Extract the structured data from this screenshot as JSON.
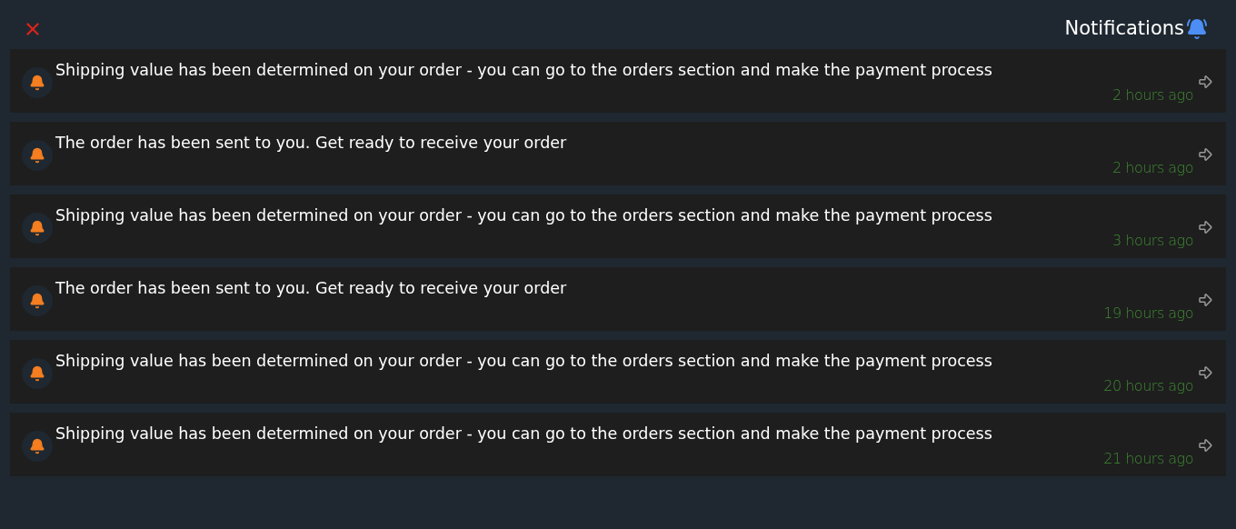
{
  "header": {
    "title": "Notifications"
  },
  "notifications": [
    {
      "message": "Shipping value has been determined on your order - you can go to the orders section and make the payment process",
      "time": "2 hours ago"
    },
    {
      "message": "The order has been sent to you. Get ready to receive your order",
      "time": "2 hours ago"
    },
    {
      "message": "Shipping value has been determined on your order - you can go to the orders section and make the payment process",
      "time": "3 hours ago"
    },
    {
      "message": "The order has been sent to you. Get ready to receive your order",
      "time": "19 hours ago"
    },
    {
      "message": "Shipping value has been determined on your order - you can go to the orders section and make the payment process",
      "time": "20 hours ago"
    },
    {
      "message": "Shipping value has been determined on your order - you can go to the orders section and make the payment process",
      "time": "21 hours ago"
    }
  ]
}
